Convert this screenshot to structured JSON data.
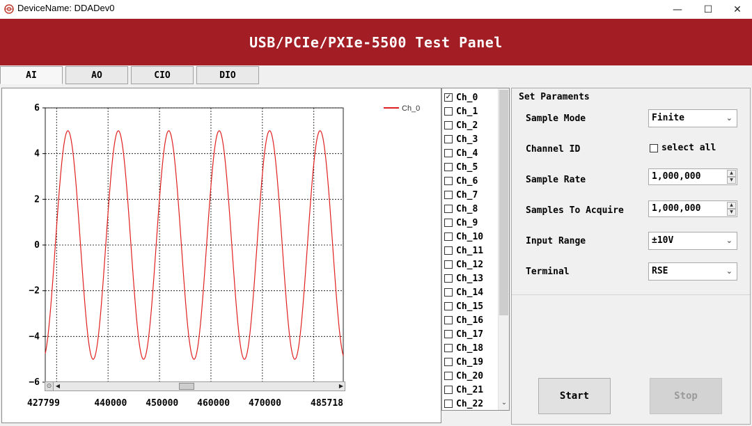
{
  "window": {
    "title": "DeviceName: DDADev0",
    "minimize_glyph": "—",
    "maximize_glyph": "☐",
    "close_glyph": "✕"
  },
  "header": {
    "title": "USB/PCIe/PXIe-5500 Test Panel",
    "color": "#a31d24"
  },
  "tabs": [
    {
      "label": "AI",
      "active": true
    },
    {
      "label": "AO",
      "active": false
    },
    {
      "label": "CIO",
      "active": false
    },
    {
      "label": "DIO",
      "active": false
    }
  ],
  "channels": {
    "items": [
      "Ch_0",
      "Ch_1",
      "Ch_2",
      "Ch_3",
      "Ch_4",
      "Ch_5",
      "Ch_6",
      "Ch_7",
      "Ch_8",
      "Ch_9",
      "Ch_10",
      "Ch_11",
      "Ch_12",
      "Ch_13",
      "Ch_14",
      "Ch_15",
      "Ch_16",
      "Ch_17",
      "Ch_18",
      "Ch_19",
      "Ch_20",
      "Ch_21",
      "Ch_22"
    ],
    "checked": [
      "Ch_0"
    ]
  },
  "settings": {
    "legend": "Set Paraments",
    "sample_mode_label": "Sample Mode",
    "sample_mode_value": "Finite",
    "channel_id_label": "Channel ID",
    "select_all_label": "select all",
    "sample_rate_label": "Sample Rate",
    "sample_rate_value": "1,000,000",
    "samples_to_acquire_label": "Samples To Acquire",
    "samples_to_acquire_value": "1,000,000",
    "input_range_label": "Input Range",
    "input_range_value": "±10V",
    "terminal_label": "Terminal",
    "terminal_value": "RSE",
    "start_label": "Start",
    "stop_label": "Stop"
  },
  "chart_data": {
    "type": "line",
    "series": [
      {
        "name": "Ch_0",
        "color": "#e02020",
        "amplitude": 5,
        "period": 9800,
        "phase_x": 427799,
        "phase_start": -0.95
      }
    ],
    "x_range": [
      427799,
      485718
    ],
    "ylim": [
      -6,
      6
    ],
    "y_ticks": [
      "6",
      "4",
      "2",
      "0",
      "−2",
      "−4",
      "−6"
    ],
    "x_tick_labels": [
      "427799",
      "440000",
      "450000",
      "460000",
      "470000",
      "485718"
    ],
    "grid": true,
    "legend_position": "top-right"
  }
}
